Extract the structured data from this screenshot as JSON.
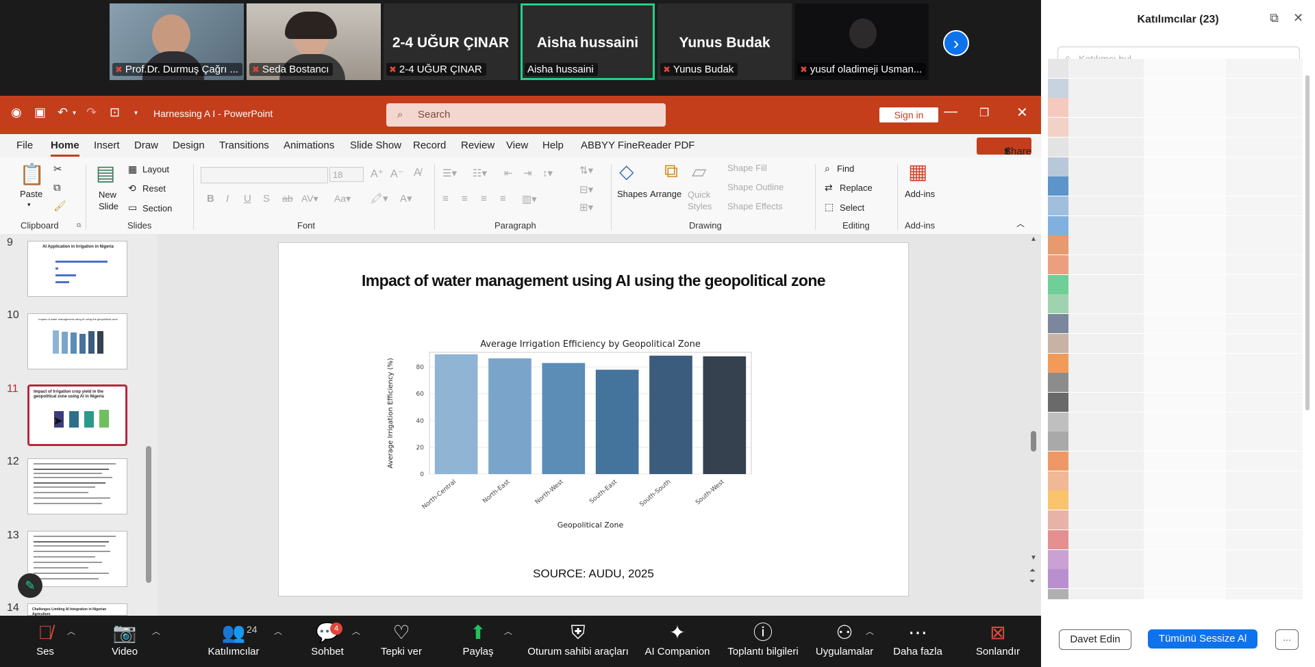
{
  "meeting": {
    "participants_tiles": [
      {
        "name": "Prof.Dr. Durmuş Çağrı ...",
        "big": ""
      },
      {
        "name": "Seda Bostancı",
        "big": ""
      },
      {
        "name": "2-4 UĞUR ÇINAR",
        "big": "2-4 UĞUR ÇINAR"
      },
      {
        "name": "Aisha hussaini",
        "big": "Aisha hussaini"
      },
      {
        "name": "Yunus Budak",
        "big": "Yunus Budak"
      },
      {
        "name": "yusuf oladimeji Usman...",
        "big": ""
      }
    ],
    "toolbar": {
      "audio": "Ses",
      "video": "Video",
      "participants": "Katılımcılar",
      "participants_count": "24",
      "chat": "Sohbet",
      "chat_badge": "4",
      "react": "Tepki ver",
      "share": "Paylaş",
      "host_tools": "Oturum sahibi araçları",
      "ai": "AI Companion",
      "info": "Toplantı bilgileri",
      "apps": "Uygulamalar",
      "more": "Daha fazla",
      "end": "Sonlandır"
    }
  },
  "panel": {
    "title": "Katılımcılar (23)",
    "search_placeholder": "Katılımcı bul",
    "invite": "Davet Edin",
    "mute_all": "Tümünü Sessize Al",
    "more": "···"
  },
  "ppt": {
    "doc_title": "Harnessing A I  -  PowerPoint",
    "search": "Search",
    "sign_in": "Sign in",
    "share": "Share",
    "menu": [
      "File",
      "Home",
      "Insert",
      "Draw",
      "Design",
      "Transitions",
      "Animations",
      "Slide Show",
      "Record",
      "Review",
      "View",
      "Help",
      "ABBYY FineReader PDF"
    ],
    "ribbon": {
      "paste": "Paste",
      "clipboard": "Clipboard",
      "new_slide": "New Slide",
      "layout": "Layout",
      "reset": "Reset",
      "section": "Section",
      "slides": "Slides",
      "font_size": "18",
      "font": "Font",
      "paragraph": "Paragraph",
      "shapes": "Shapes",
      "arrange": "Arrange",
      "quick_styles": "Quick Styles",
      "shape_fill": "Shape Fill",
      "shape_outline": "Shape Outline",
      "shape_effects": "Shape Effects",
      "drawing": "Drawing",
      "find": "Find",
      "replace": "Replace",
      "select": "Select",
      "editing": "Editing",
      "addins": "Add-ins",
      "addins_group": "Add-ins"
    },
    "thumbnails": [
      {
        "num": "9",
        "title": "AI Application in Irrigation in Nigeria"
      },
      {
        "num": "10",
        "title": "Impact of water management using AI using the geopolitical zone"
      },
      {
        "num": "11",
        "title": "Impact of Irrigation crop yield in the geopolitical zone using AI in Nigeria"
      },
      {
        "num": "12",
        "title": ""
      },
      {
        "num": "13",
        "title": ""
      },
      {
        "num": "14",
        "title": "Challenges Limiting AI Integration in Nigerian Agriculture"
      }
    ],
    "slide": {
      "title": "Impact of water management using AI using the geopolitical zone",
      "source": "SOURCE: AUDU, 2025"
    }
  },
  "chart_data": {
    "type": "bar",
    "title": "Average Irrigation Efficiency by Geopolitical Zone",
    "xlabel": "Geopolitical Zone",
    "ylabel": "Average Irrigation Efficiency (%)",
    "categories": [
      "North-Central",
      "North-East",
      "North-West",
      "South-East",
      "South-South",
      "South-West"
    ],
    "values": [
      89.5,
      86.5,
      83,
      78,
      88.5,
      88
    ],
    "ylim": [
      0,
      91
    ],
    "yticks": [
      0,
      20,
      40,
      60,
      80
    ],
    "colors": [
      "#8fb4d4",
      "#7aa4c9",
      "#5b8db6",
      "#44739c",
      "#3b5c7d",
      "#35414f"
    ],
    "grid": true
  }
}
